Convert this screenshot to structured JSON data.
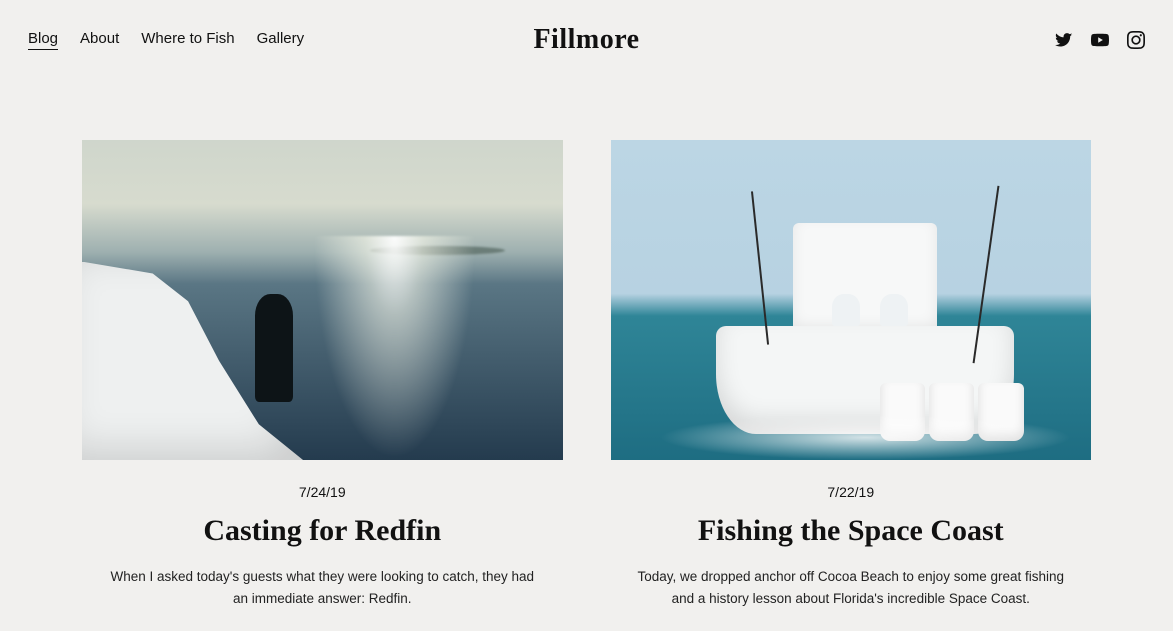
{
  "site": {
    "title": "Fillmore"
  },
  "nav": {
    "items": [
      {
        "label": "Blog",
        "active": true
      },
      {
        "label": "About",
        "active": false
      },
      {
        "label": "Where to Fish",
        "active": false
      },
      {
        "label": "Gallery",
        "active": false
      }
    ]
  },
  "social": {
    "twitter": "twitter-icon",
    "youtube": "youtube-icon",
    "instagram": "instagram-icon"
  },
  "posts": [
    {
      "date": "7/24/19",
      "title": "Casting for Redfin",
      "excerpt": "When I asked today's guests what they were looking to catch, they had an immediate answer: Redfin."
    },
    {
      "date": "7/22/19",
      "title": "Fishing the Space Coast",
      "excerpt": "Today, we dropped anchor off Cocoa Beach to enjoy some great fishing and a history lesson about Florida's incredible Space Coast."
    }
  ]
}
